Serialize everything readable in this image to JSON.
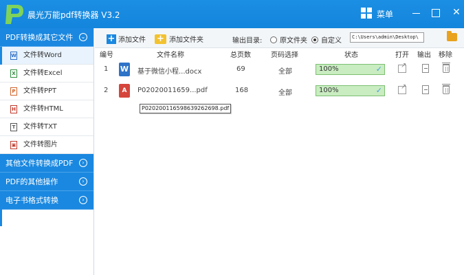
{
  "app": {
    "title": "晨光万能pdf转换器 V3.2",
    "menu_label": "菜单"
  },
  "sidebar": {
    "section1": {
      "label": "PDF转换成其它文件",
      "icon": "chevron-down-icon"
    },
    "items": [
      {
        "label": "文件转Word",
        "icon": "word-file-icon",
        "active": true
      },
      {
        "label": "文件转Excel",
        "icon": "excel-file-icon"
      },
      {
        "label": "文件转PPT",
        "icon": "ppt-file-icon"
      },
      {
        "label": "文件转HTML",
        "icon": "html-file-icon"
      },
      {
        "label": "文件转TXT",
        "icon": "txt-file-icon"
      },
      {
        "label": "文件转图片",
        "icon": "image-file-icon"
      }
    ],
    "section2": {
      "label": "其他文件转换成PDF",
      "icon": "chevron-right-icon"
    },
    "section3": {
      "label": "PDF的其他操作",
      "icon": "chevron-right-icon"
    },
    "section4": {
      "label": "电子书格式转换",
      "icon": "chevron-right-icon"
    }
  },
  "toolbar": {
    "add_file": "添加文件",
    "add_folder": "添加文件夹",
    "output_label": "输出目录:",
    "option_original": "原文件夹",
    "option_custom": "自定义",
    "selected_option": "自定义",
    "path": "C:\\Users\\admin\\Desktop\\"
  },
  "table": {
    "headers": {
      "index": "编号",
      "name": "文件名称",
      "pages": "总页数",
      "range": "页码选择",
      "status": "状态",
      "open": "打开",
      "export": "输出",
      "remove": "移除"
    },
    "rows": [
      {
        "index": "1",
        "type": "word",
        "type_icon_text": "W",
        "name": "基于微信小程...docx",
        "pages": "69",
        "range": "全部",
        "progress_text": "100%",
        "progress": 1.0
      },
      {
        "index": "2",
        "type": "pdf",
        "type_icon_text": "A",
        "name": "P02020011659...pdf",
        "pages": "168",
        "range": "全部",
        "progress_text": "100%",
        "progress": 1.0
      }
    ]
  },
  "tooltip": "P020200116598639262698.pdf",
  "colors": {
    "accent": "#1a88e0",
    "progress_bg": "#e6f5e2",
    "progress_border": "#7ac070"
  }
}
